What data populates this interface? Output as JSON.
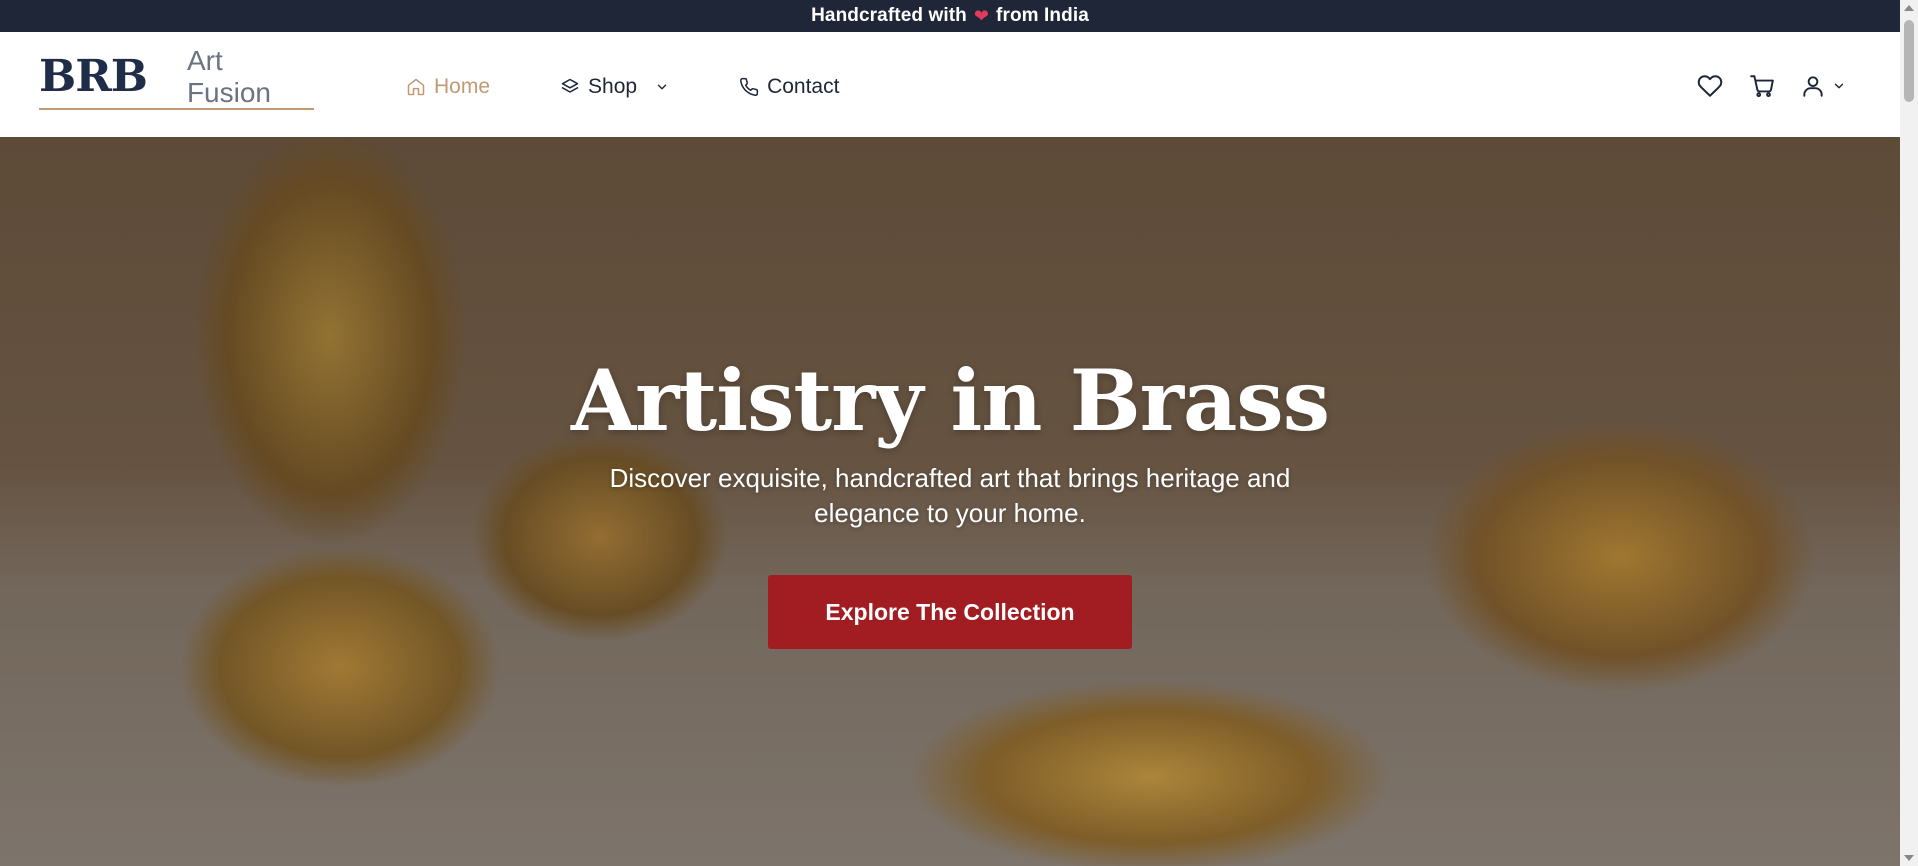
{
  "announcement": {
    "text_before": "Handcrafted with",
    "heart": "❤",
    "text_after": "from India"
  },
  "header": {
    "logo_main": "BRB",
    "logo_sub": "Art Fusion",
    "nav": [
      {
        "label": "Home",
        "icon": "home-icon",
        "active": true
      },
      {
        "label": "Shop",
        "icon": "layers-icon",
        "has_dropdown": true
      },
      {
        "label": "Contact",
        "icon": "phone-icon"
      }
    ],
    "actions": [
      "heart-icon",
      "cart-icon",
      "user-icon"
    ]
  },
  "hero": {
    "title": "Artistry in Brass",
    "subtitle": "Discover exquisite, handcrafted art that brings heritage and elegance to your home.",
    "cta": "Explore The Collection"
  },
  "colors": {
    "accent": "#c19a74",
    "navy": "#1f2638",
    "cta": "#a11d21"
  }
}
